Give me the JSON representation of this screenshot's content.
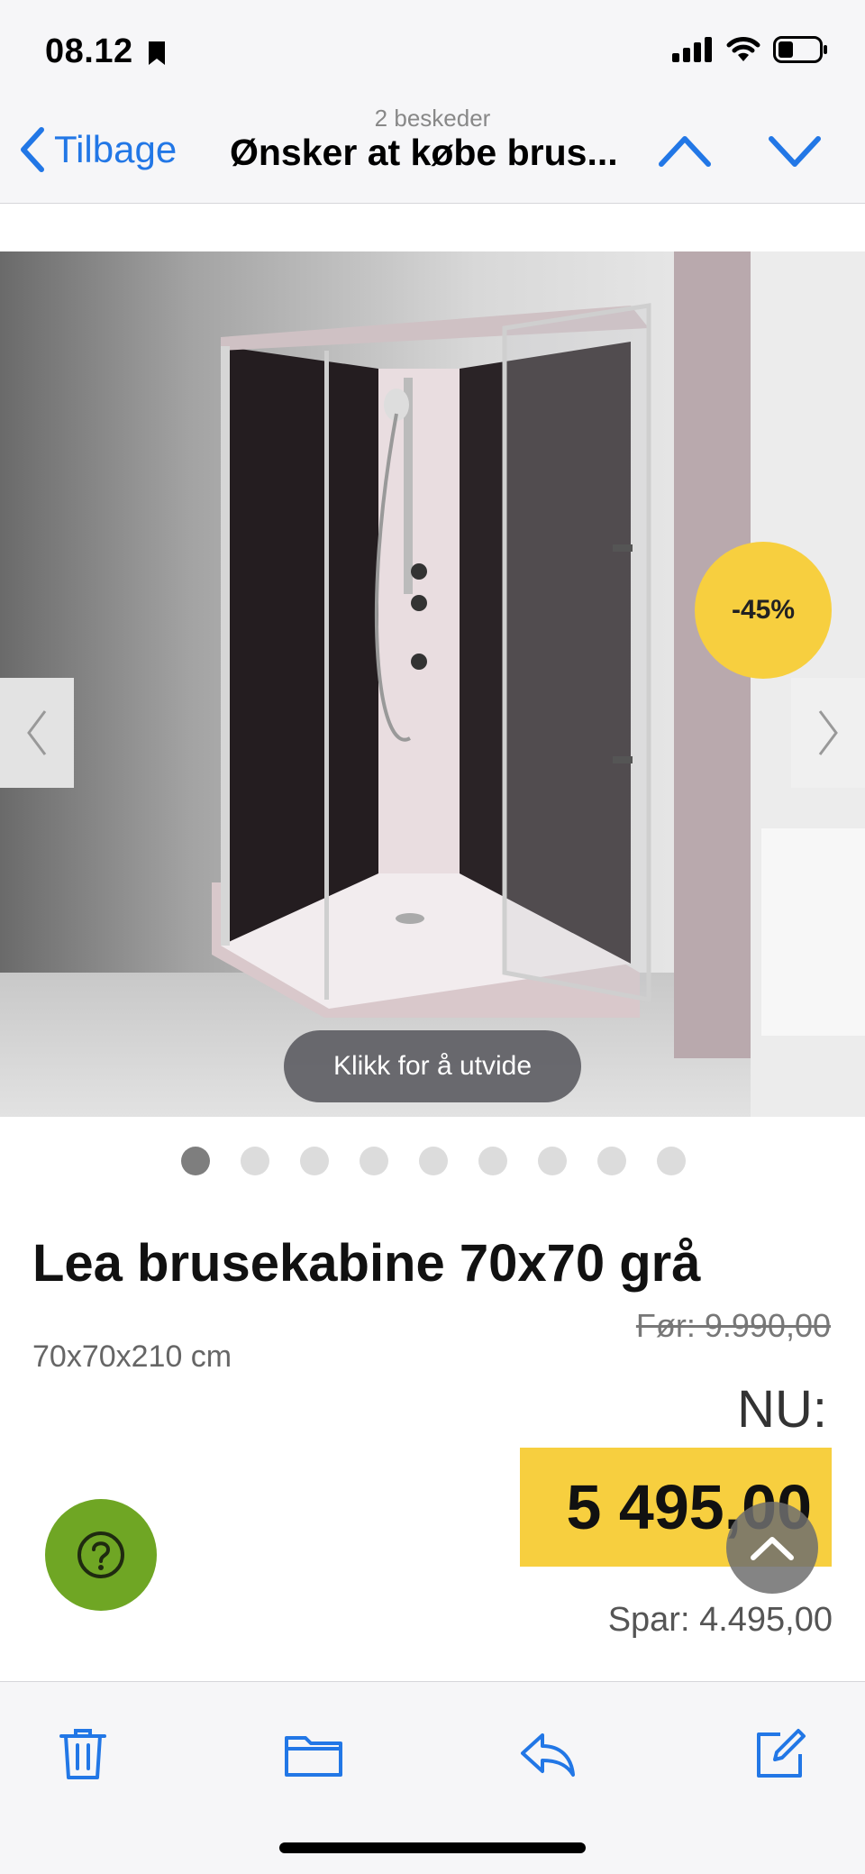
{
  "status_bar": {
    "time": "08.12"
  },
  "nav": {
    "back_label": "Tilbage",
    "message_count": "2 beskeder",
    "subject": "Ønsker at købe brus..."
  },
  "product": {
    "discount_badge": "-45%",
    "expand_label": "Klikk for å utvide",
    "gallery_dot_count": 9,
    "gallery_active_index": 0,
    "title": "Lea brusekabine 70x70 grå",
    "dimensions": "70x70x210 cm",
    "before_price": "Før: 9.990,00",
    "now_label": "NU:",
    "price": "5 495,00",
    "save_text": "Spar: 4.495,00"
  },
  "colors": {
    "accent_blue": "#2277e6",
    "badge_yellow": "#f7cf3f",
    "help_green": "#6fa624"
  }
}
